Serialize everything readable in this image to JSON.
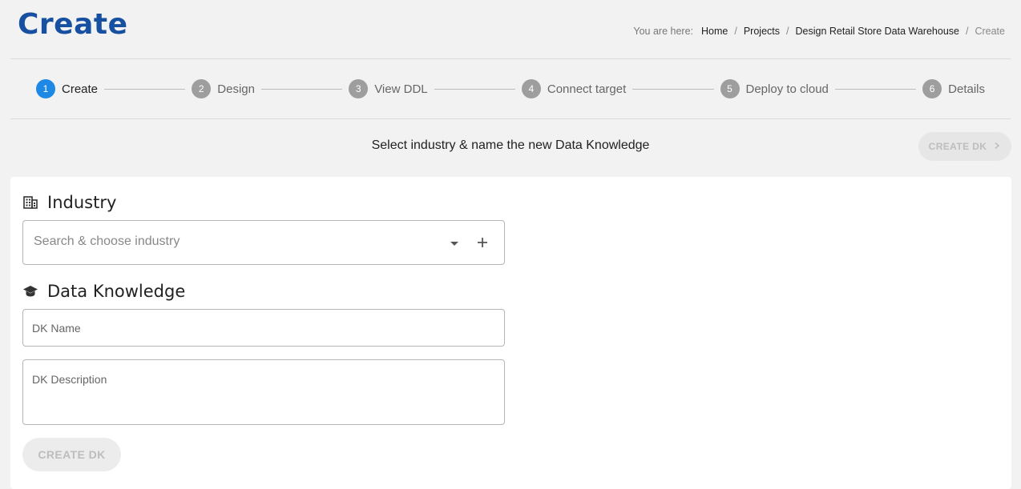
{
  "header": {
    "title": "Create"
  },
  "breadcrumb": {
    "prefix": "You are here:",
    "items": [
      "Home",
      "Projects",
      "Design Retail Store Data Warehouse"
    ],
    "current": "Create"
  },
  "stepper": {
    "steps": [
      {
        "number": "1",
        "label": "Create",
        "active": true
      },
      {
        "number": "2",
        "label": "Design",
        "active": false
      },
      {
        "number": "3",
        "label": "View DDL",
        "active": false
      },
      {
        "number": "4",
        "label": "Connect target",
        "active": false
      },
      {
        "number": "5",
        "label": "Deploy to cloud",
        "active": false
      },
      {
        "number": "6",
        "label": "Details",
        "active": false
      }
    ]
  },
  "instruction": "Select industry & name the new Data Knowledge",
  "toolbar": {
    "create_dk_label": "CREATE DK",
    "icon": "chevron-right-icon"
  },
  "industry": {
    "title": "Industry",
    "icon": "building-icon",
    "placeholder": "Search & choose industry",
    "dropdown_icon": "caret-down-icon",
    "add_icon": "plus-icon"
  },
  "data_knowledge": {
    "title": "Data Knowledge",
    "icon": "graduation-cap-icon",
    "name_placeholder": "DK Name",
    "description_placeholder": "DK Description",
    "create_label": "CREATE DK"
  },
  "colors": {
    "title": "#1750a0",
    "active_step": "#1e88e5",
    "inactive_step": "#9e9e9e",
    "disabled_button_bg": "#e6e6e6",
    "disabled_button_text": "#bdbdbd"
  }
}
